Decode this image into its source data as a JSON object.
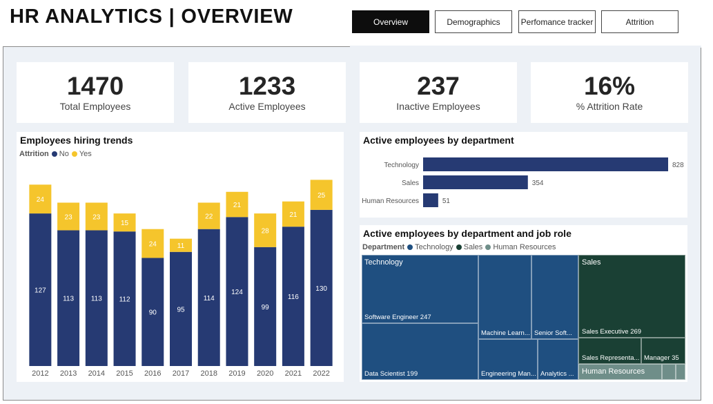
{
  "header": {
    "title": "HR ANALYTICS | OVERVIEW",
    "nav": [
      {
        "label": "Overview",
        "active": true
      },
      {
        "label": "Demographics",
        "active": false
      },
      {
        "label": "Perfomance tracker",
        "active": false
      },
      {
        "label": "Attrition",
        "active": false
      }
    ]
  },
  "kpis": [
    {
      "value": "1470",
      "label": "Total Employees"
    },
    {
      "value": "1233",
      "label": "Active Employees"
    },
    {
      "value": "237",
      "label": "Inactive Employees"
    },
    {
      "value": "16%",
      "label": "% Attrition Rate"
    }
  ],
  "hiring": {
    "title": "Employees hiring trends",
    "legend_title": "Attrition",
    "legend": [
      {
        "name": "No",
        "color": "#263a73"
      },
      {
        "name": "Yes",
        "color": "#f5c52c"
      }
    ]
  },
  "dept": {
    "title": "Active employees by department"
  },
  "treemap": {
    "title": "Active employees by department and job role",
    "legend_title": "Department",
    "legend": [
      {
        "name": "Technology",
        "color": "#1f4f80"
      },
      {
        "name": "Sales",
        "color": "#1a4034"
      },
      {
        "name": "Human Resources",
        "color": "#6f8e89"
      }
    ],
    "groups": {
      "technology": "Technology",
      "sales": "Sales",
      "hr": "Human Resources"
    },
    "cells": {
      "se": "Software Engineer 247",
      "ds": "Data Scientist 199",
      "ml": "Machine Learn...",
      "ss": "Senior Soft...",
      "em": "Engineering Man...",
      "an": "Analytics ...",
      "sx": "Sales Executive 269",
      "sr": "Sales Representa...",
      "mg": "Manager 35"
    }
  },
  "chart_data": [
    {
      "type": "bar",
      "stacked": true,
      "title": "Employees hiring trends",
      "categories": [
        "2012",
        "2013",
        "2014",
        "2015",
        "2016",
        "2017",
        "2018",
        "2019",
        "2020",
        "2021",
        "2022"
      ],
      "series": [
        {
          "name": "No",
          "color": "#263a73",
          "values": [
            127,
            113,
            113,
            112,
            90,
            95,
            114,
            124,
            99,
            116,
            130
          ]
        },
        {
          "name": "Yes",
          "color": "#f5c52c",
          "values": [
            24,
            23,
            23,
            15,
            24,
            11,
            22,
            21,
            28,
            21,
            25
          ]
        }
      ],
      "ylim": [
        0,
        165
      ],
      "grid": false,
      "legend_position": "top-left"
    },
    {
      "type": "bar",
      "orientation": "horizontal",
      "title": "Active employees by department",
      "categories": [
        "Technology",
        "Sales",
        "Human Resources"
      ],
      "values": [
        828,
        354,
        51
      ],
      "color": "#263a73",
      "xlim": [
        0,
        828
      ]
    }
  ]
}
